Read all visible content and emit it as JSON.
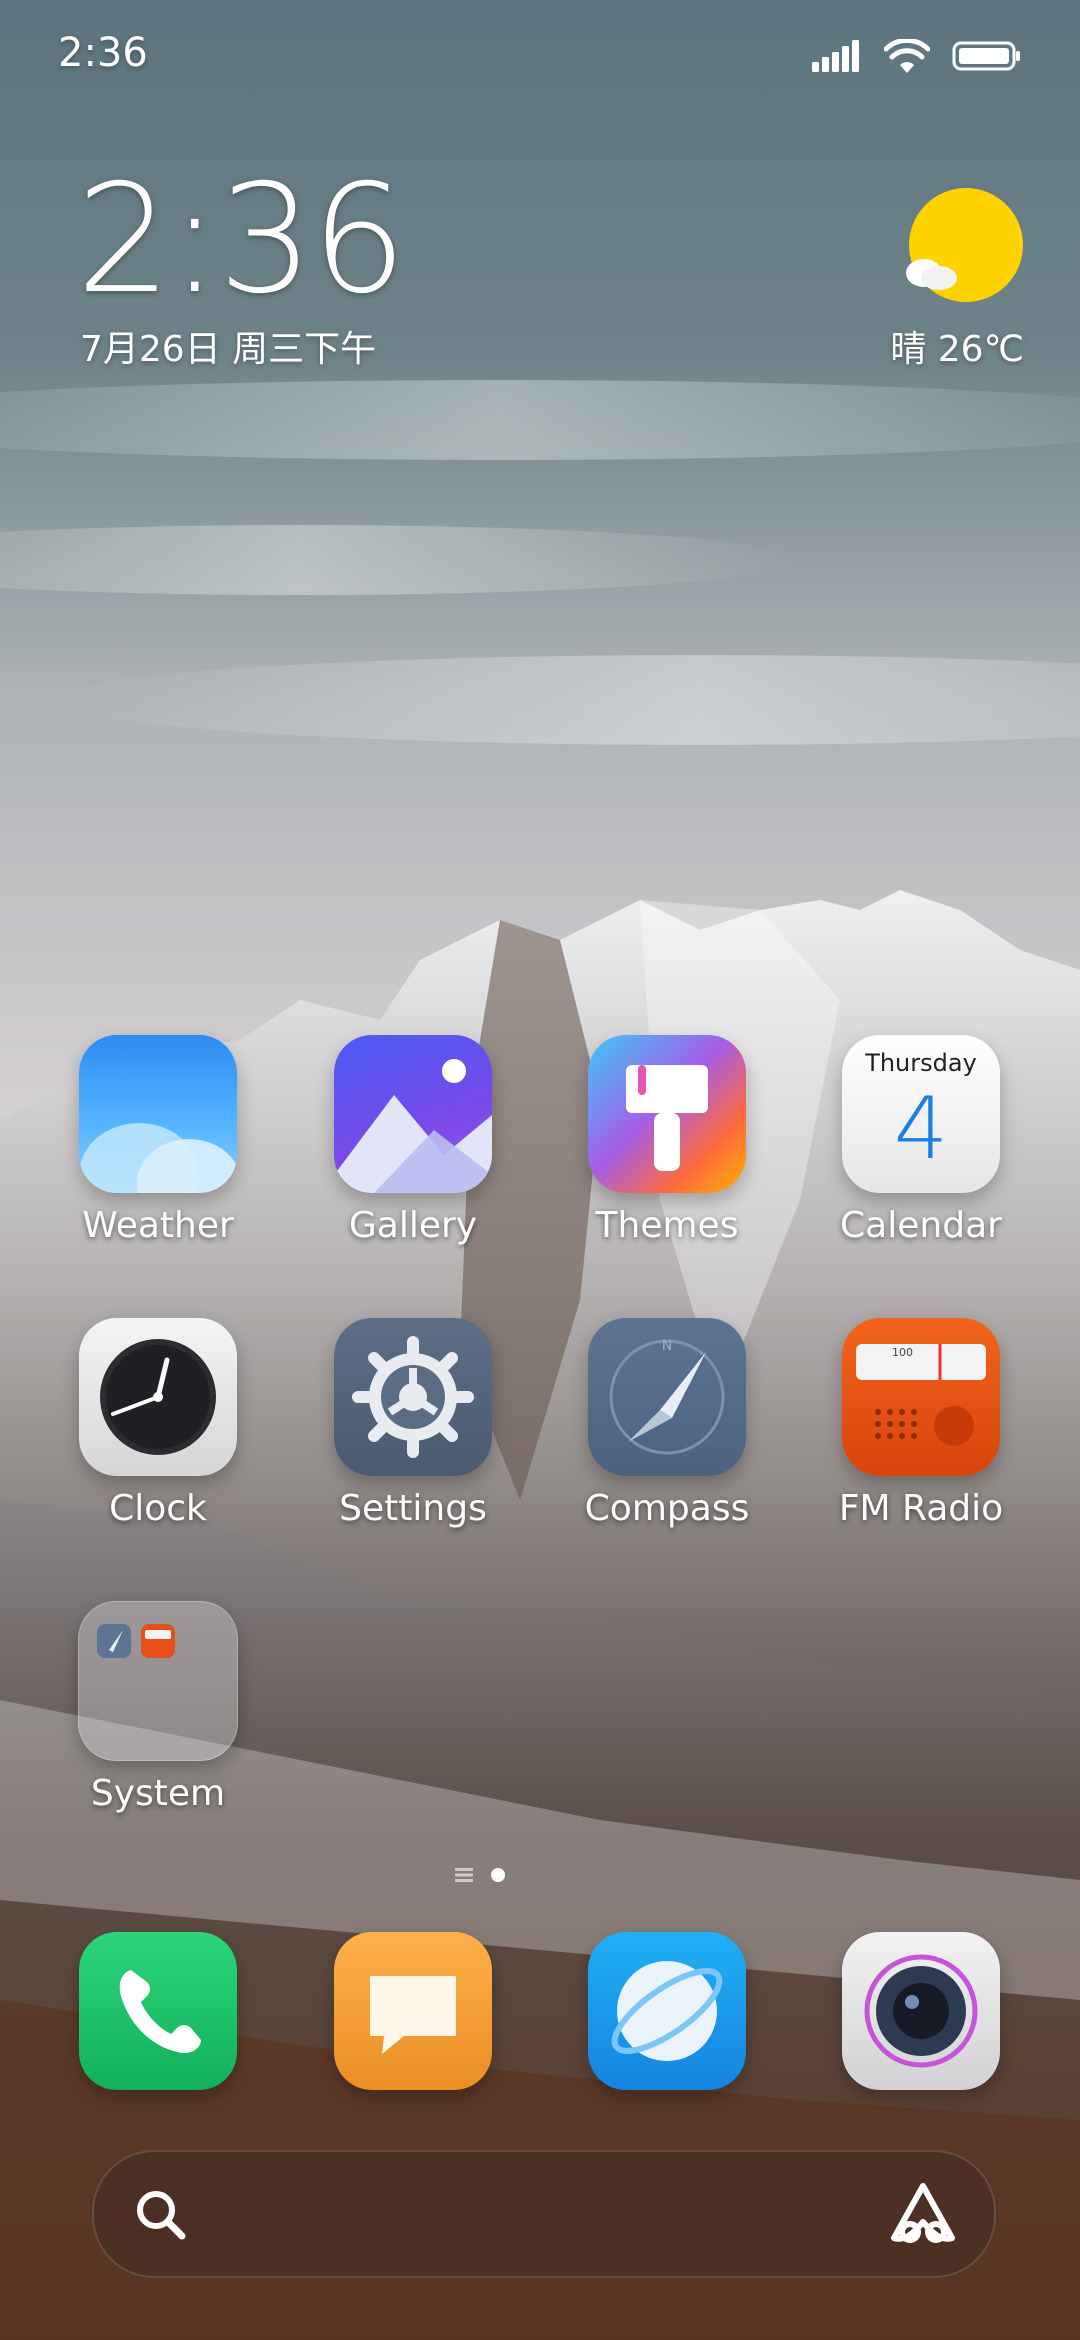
{
  "status_bar": {
    "time": "2:36"
  },
  "clock_widget": {
    "time": "2:36",
    "date": "7月26日 周三下午"
  },
  "weather_widget": {
    "text": "晴 26℃"
  },
  "apps": {
    "row1": [
      {
        "label": "Weather"
      },
      {
        "label": "Gallery"
      },
      {
        "label": "Themes"
      },
      {
        "label": "Calendar",
        "day_name": "Thursday",
        "day_number": "4"
      }
    ],
    "row2": [
      {
        "label": "Clock"
      },
      {
        "label": "Settings"
      },
      {
        "label": "Compass"
      },
      {
        "label": "FM Radio",
        "dial_number": "100"
      }
    ],
    "folder": {
      "label": "System"
    }
  },
  "dock": {
    "apps": [
      "phone-icon",
      "messages-icon",
      "browser-icon",
      "camera-icon"
    ]
  },
  "colors": {
    "sky_top": "#5f7780",
    "sky_mid": "#c8c8cc",
    "rock_dark": "#3a3634",
    "snow": "#e8e8ec",
    "sun": "#ffd200"
  }
}
